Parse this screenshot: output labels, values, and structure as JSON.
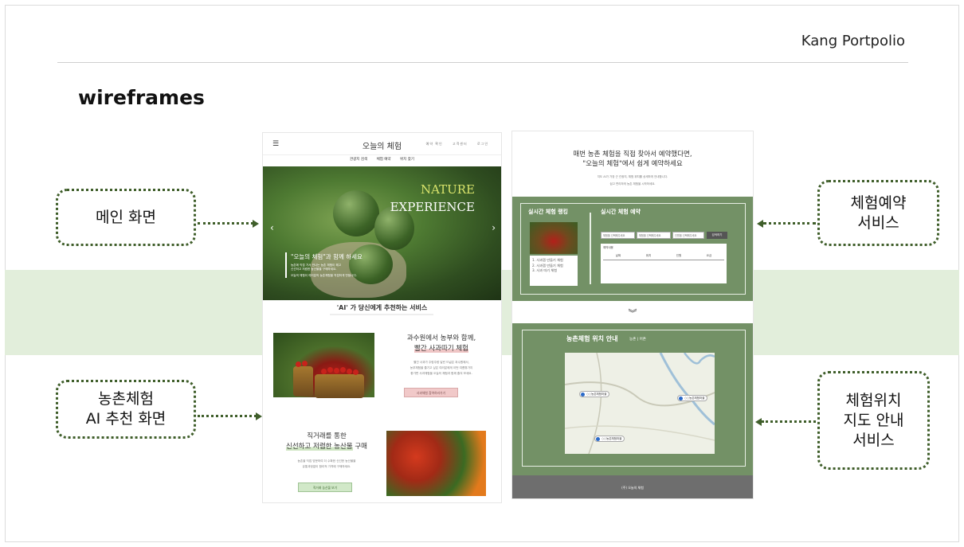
{
  "header": {
    "brand": "Kang Portpolio",
    "title": "wireframes"
  },
  "callouts": {
    "main": "메인 화면",
    "ai": "농촌체험\nAI 추천 화면",
    "booking": "체험예약\n서비스",
    "location": "체험위치\n지도 안내\n서비스"
  },
  "wf_main": {
    "logo": "오늘의 체험",
    "menu_icon": "☰",
    "util_links": [
      "예약 확인",
      "고객센터",
      "로그인"
    ],
    "nav": [
      "관광지 검색",
      "체험 예약",
      "위치 찾기"
    ],
    "hero": {
      "line1": "NATURE",
      "line2": "EXPERIENCE",
      "prev": "‹",
      "next": "›",
      "quote": "\"오늘의 체험\"과 함께 하세요",
      "desc1": "농촌에 직접 가서 만나는 농촌 체험이 해고",
      "desc2": "신선하고 저렴한 농산물을 구매하세요.",
      "desc3": "오늘의 체험이 여러분의 농촌체험을 직접하게 만듭니다."
    },
    "section_title": "'AI' 가 당신에게 추천하는 서비스",
    "card1": {
      "title1": "과수원에서 농부와 함께,",
      "title2": "빨간 사과따기 체험",
      "body1": "빨간 사과가 주렁주렁 달린 드넓은 과수원에서,",
      "body2": "농부체험을 즐기고 싶은 여러분에게 이번 여름휴가지",
      "body3": "좋가면 사과체험을 오늘의 체험과 함께 즐겨 보세요.",
      "button": "사과체험 참여하러가기"
    },
    "card2": {
      "title1": "직거래를 통한",
      "title2a": "신선하고 저렴한 농산물",
      "title2b": " 구매",
      "body1": "농촌을 직접 방문하여 더 수확한 신선한 농산물을",
      "body2": "유통과정없이 합리적 가격에 구매하세요.",
      "button": "직거래 농산물 보기"
    }
  },
  "wf_booking": {
    "intro1": "매번 농촌 체험을 직접 찾아서 예약했다면,",
    "intro2": "\"오늘의 체험\"에서 쉽게 예약하세요",
    "sub1": "지도 AI가 가장 근 관광지, 체험 위치를 상세하게 안내합니다.",
    "sub2": "쉽고 편리하게 농촌 체험을 시작하세요.",
    "ranking_title": "실시간 체험 랭킹",
    "ranking": [
      "1. 사과잼 만들기 체험",
      "2. 사과잼 만들기 체험",
      "3. 사과 따기 체험"
    ],
    "booking_title": "실시간 체험 예약",
    "selects": [
      "체험을 선택해주세요",
      "체험을 선택해주세요",
      "인원을 선택해주세요"
    ],
    "search_btn": "검색하기",
    "table_caption": "예약내용",
    "table_headers": [
      "날짜",
      "위치",
      "인원",
      "요금"
    ],
    "down_chevron": "︾",
    "location_title": "농촌체험 위치 안내",
    "location_tabs": "농촌 | 어촌",
    "pins": [
      "○○농촌체험마을",
      "○○농촌체험마을",
      "○○농촌체험마을"
    ],
    "footer": "(주) 오늘의 체험"
  },
  "colors": {
    "green_panel": "#739166",
    "band": "#e2eedb",
    "dotted": "#3f5e2a",
    "pink": "#f1c9c9"
  }
}
